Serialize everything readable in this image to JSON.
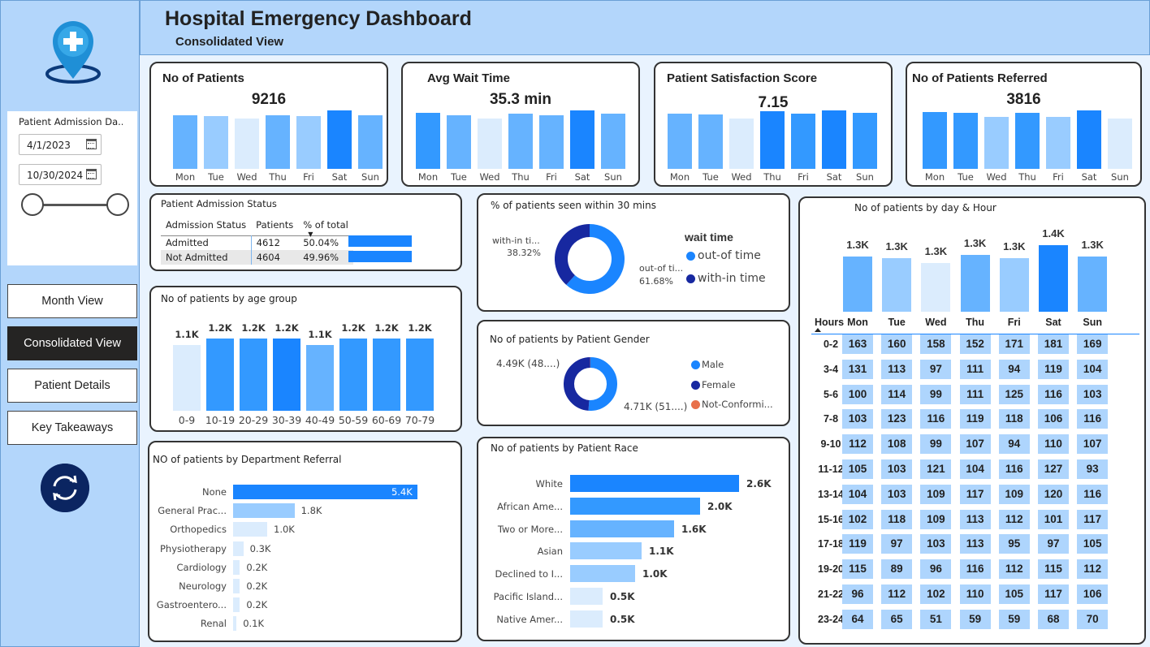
{
  "header": {
    "title": "Hospital Emergency Dashboard",
    "subtitle": "Consolidated View"
  },
  "sidebar": {
    "logo_icon": "hospital-location-pin-icon",
    "slicer": {
      "title": "Patient Admission Da...",
      "start_date": "4/1/2023",
      "end_date": "10/30/2024"
    },
    "nav": [
      {
        "label": "Month View",
        "active": false
      },
      {
        "label": "Consolidated View",
        "active": true
      },
      {
        "label": "Patient Details",
        "active": false
      },
      {
        "label": "Key Takeaways",
        "active": false
      }
    ],
    "refresh_icon": "refresh-icon"
  },
  "colors": {
    "darkest": "#1a85ff",
    "dark": "#3399ff",
    "medium": "#66b3ff",
    "light": "#99ccff",
    "lightest": "#dbecfd",
    "navy": "#1728a0",
    "orange": "#e8704a"
  },
  "kpis": [
    {
      "title": "No of Patients",
      "value": "9216",
      "chart_data": {
        "type": "bar",
        "categories": [
          "Mon",
          "Tue",
          "Wed",
          "Thu",
          "Fri",
          "Sat",
          "Sun"
        ],
        "values": [
          1320,
          1315,
          1280,
          1325,
          1310,
          1390,
          1325
        ]
      }
    },
    {
      "title": "Avg Wait Time",
      "value": "35.3 min",
      "chart_data": {
        "type": "bar",
        "categories": [
          "Mon",
          "Tue",
          "Wed",
          "Thu",
          "Fri",
          "Sat",
          "Sun"
        ],
        "values": [
          35.4,
          35.2,
          34.9,
          35.3,
          35.2,
          35.6,
          35.3
        ]
      }
    },
    {
      "title": "Patient Satisfaction Score",
      "value": "7.15",
      "chart_data": {
        "type": "bar",
        "categories": [
          "Mon",
          "Tue",
          "Wed",
          "Thu",
          "Fri",
          "Sat",
          "Sun"
        ],
        "values": [
          7.13,
          7.12,
          7.05,
          7.17,
          7.14,
          7.19,
          7.15
        ]
      }
    },
    {
      "title": "No of Patients Referred",
      "value": "3816",
      "chart_data": {
        "type": "bar",
        "categories": [
          "Mon",
          "Tue",
          "Wed",
          "Thu",
          "Fri",
          "Sat",
          "Sun"
        ],
        "values": [
          560,
          552,
          522,
          555,
          520,
          570,
          510
        ]
      }
    }
  ],
  "admission": {
    "title": "Patient Admission Status",
    "columns": [
      "Admission Status",
      "Patients",
      "% of total"
    ],
    "rows": [
      {
        "status": "Admitted",
        "patients": "4612",
        "pct": "50.04%",
        "share": 50.04
      },
      {
        "status": "Not Admitted",
        "patients": "4604",
        "pct": "49.96%",
        "share": 49.96
      }
    ]
  },
  "age_group": {
    "title": "No of patients by age group",
    "chart_data": {
      "type": "bar",
      "categories": [
        "0-9",
        "10-19",
        "20-29",
        "30-39",
        "40-49",
        "50-59",
        "60-69",
        "70-79"
      ],
      "values": [
        1.1,
        1.2,
        1.2,
        1.2,
        1.1,
        1.2,
        1.2,
        1.2
      ],
      "labels": [
        "1.1K",
        "1.2K",
        "1.2K",
        "1.2K",
        "1.1K",
        "1.2K",
        "1.2K",
        "1.2K"
      ]
    }
  },
  "department": {
    "title": "NO of patients by Department Referral",
    "chart_data": {
      "type": "bar",
      "categories": [
        "None",
        "General Prac...",
        "Orthopedics",
        "Physiotherapy",
        "Cardiology",
        "Neurology",
        "Gastroentero...",
        "Renal"
      ],
      "values": [
        5.4,
        1.8,
        1.0,
        0.3,
        0.2,
        0.2,
        0.2,
        0.1
      ],
      "labels": [
        "5.4K",
        "1.8K",
        "1.0K",
        "0.3K",
        "0.2K",
        "0.2K",
        "0.2K",
        "0.1K"
      ]
    }
  },
  "within30": {
    "title": "% of patients seen within 30 mins",
    "legend_title": "wait time",
    "chart_data": {
      "type": "pie",
      "slices": [
        {
          "name": "out-of time",
          "value": 61.68
        },
        {
          "name": "with-in time",
          "value": 38.32
        }
      ]
    },
    "label_within": "with-in ti...",
    "label_within_pct": "38.32%",
    "label_out": "out-of ti...",
    "label_out_pct": "61.68%",
    "legend": [
      "out-of time",
      "with-in time"
    ]
  },
  "gender": {
    "title": "No of patients by Patient Gender",
    "chart_data": {
      "type": "pie",
      "slices": [
        {
          "name": "Male",
          "value": 51.2
        },
        {
          "name": "Female",
          "value": 48.7
        },
        {
          "name": "Not-Conforming",
          "value": 0.1
        }
      ]
    },
    "label_female": "4.49K (48....)",
    "label_male": "4.71K (51....)",
    "legend": [
      "Male",
      "Female",
      "Not-Conformi..."
    ]
  },
  "race": {
    "title": "No of patients by Patient Race",
    "chart_data": {
      "type": "bar",
      "categories": [
        "White",
        "African Ame...",
        "Two or More...",
        "Asian",
        "Declined to I...",
        "Pacific Island...",
        "Native Amer..."
      ],
      "values": [
        2.6,
        2.0,
        1.6,
        1.1,
        1.0,
        0.5,
        0.5
      ],
      "labels": [
        "2.6K",
        "2.0K",
        "1.6K",
        "1.1K",
        "1.0K",
        "0.5K",
        "0.5K"
      ]
    }
  },
  "day_hour": {
    "title": "No of patients by day & Hour",
    "hours_header": "Hours",
    "days": [
      "Mon",
      "Tue",
      "Wed",
      "Thu",
      "Fri",
      "Sat",
      "Sun"
    ],
    "day_totals": [
      1.32,
      1.31,
      1.28,
      1.33,
      1.31,
      1.39,
      1.32
    ],
    "day_labels": [
      "1.3K",
      "1.3K",
      "1.3K",
      "1.3K",
      "1.3K",
      "1.4K",
      "1.3K"
    ],
    "hours": [
      "0-2",
      "3-4",
      "5-6",
      "7-8",
      "9-10",
      "11-12",
      "13-14",
      "15-16",
      "17-18",
      "19-20",
      "21-22",
      "23-24"
    ],
    "matrix": [
      [
        163,
        160,
        158,
        152,
        171,
        181,
        169
      ],
      [
        131,
        113,
        97,
        111,
        94,
        119,
        104
      ],
      [
        100,
        114,
        99,
        111,
        125,
        116,
        103
      ],
      [
        103,
        123,
        116,
        119,
        118,
        106,
        116
      ],
      [
        112,
        108,
        99,
        107,
        94,
        110,
        107
      ],
      [
        105,
        103,
        121,
        104,
        116,
        127,
        93
      ],
      [
        104,
        103,
        109,
        117,
        109,
        120,
        116
      ],
      [
        102,
        118,
        109,
        113,
        112,
        101,
        117
      ],
      [
        119,
        97,
        103,
        113,
        95,
        97,
        105
      ],
      [
        115,
        89,
        96,
        116,
        112,
        115,
        112
      ],
      [
        96,
        112,
        102,
        110,
        105,
        117,
        106
      ],
      [
        64,
        65,
        51,
        59,
        59,
        68,
        70
      ]
    ]
  }
}
